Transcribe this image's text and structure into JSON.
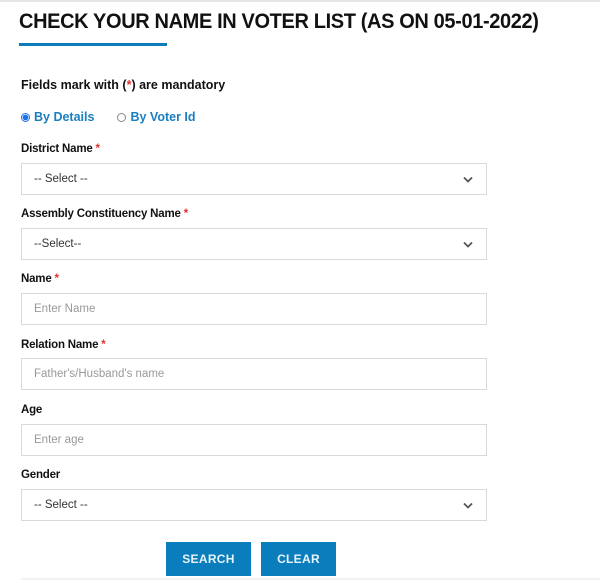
{
  "page": {
    "title": "CHECK YOUR NAME IN VOTER LIST (AS ON 05-01-2022)",
    "accent_color": "#0e7cb8"
  },
  "form": {
    "mandatory_note": {
      "prefix": "Fields mark with (",
      "star": "*",
      "suffix": ") are mandatory"
    },
    "search_mode": {
      "options": [
        {
          "label": "By Details",
          "selected": true
        },
        {
          "label": "By Voter Id",
          "selected": false
        }
      ]
    },
    "fields": {
      "district": {
        "label": "District Name",
        "required": "*",
        "type": "select",
        "value": "-- Select --"
      },
      "assembly": {
        "label": "Assembly Constituency Name",
        "required": "*",
        "type": "select",
        "value": "--Select--"
      },
      "name": {
        "label": "Name",
        "required": "*",
        "type": "input",
        "placeholder": "Enter Name"
      },
      "relation": {
        "label": "Relation Name",
        "required": "*",
        "type": "input",
        "placeholder": "Father's/Husband's name"
      },
      "age": {
        "label": "Age",
        "type": "input",
        "placeholder": "Enter age"
      },
      "gender": {
        "label": "Gender",
        "type": "select",
        "value": "-- Select --"
      }
    },
    "buttons": {
      "search": "SEARCH",
      "clear": "CLEAR"
    }
  }
}
